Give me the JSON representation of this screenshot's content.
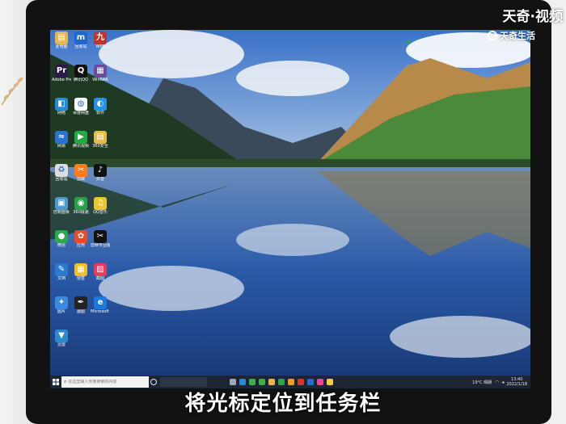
{
  "watermark": {
    "top_text": "天奇·视频",
    "logo_text": "天奇生活"
  },
  "caption": "将光标定位到任务栏",
  "desktop": {
    "icons": [
      {
        "name": "此电脑",
        "color": "#e8b84a",
        "glyph": "▤"
      },
      {
        "name": "回收站",
        "color": "#1e66d0",
        "glyph": "m"
      },
      {
        "name": "WPS",
        "color": "#c0322b",
        "glyph": "九"
      },
      {
        "name": "Adobe Premiere",
        "color": "#2a1a4a",
        "glyph": "Pr"
      },
      {
        "name": "腾讯QQ",
        "color": "#111111",
        "glyph": "Q"
      },
      {
        "name": "WinRAR",
        "color": "#6a4a9a",
        "glyph": "▦"
      },
      {
        "name": "网络",
        "color": "#2a8ad0",
        "glyph": "◧"
      },
      {
        "name": "百度网盘",
        "color": "#ffffff",
        "glyph": "◍"
      },
      {
        "name": "软件",
        "color": "#2a90e0",
        "glyph": "◐"
      },
      {
        "name": "网易",
        "color": "#2a72d0",
        "glyph": "≈"
      },
      {
        "name": "腾讯视频",
        "color": "#22aa44",
        "glyph": "▶"
      },
      {
        "name": "360安全",
        "color": "#e8b84a",
        "glyph": "▤"
      },
      {
        "name": "回收站",
        "color": "#dddddd",
        "glyph": "♻"
      },
      {
        "name": "剪映",
        "color": "#ff7a1a",
        "glyph": "✂"
      },
      {
        "name": "抖音",
        "color": "#111111",
        "glyph": "♪"
      },
      {
        "name": "控制面板",
        "color": "#4a9ad0",
        "glyph": "▣"
      },
      {
        "name": "360极速",
        "color": "#2aa04a",
        "glyph": "◉"
      },
      {
        "name": "QQ音乐",
        "color": "#e8c830",
        "glyph": "♫"
      },
      {
        "name": "微信",
        "color": "#2aa84a",
        "glyph": "●"
      },
      {
        "name": "应用",
        "color": "#e84a2a",
        "glyph": "✿"
      },
      {
        "name": "剪映专业版",
        "color": "#111111",
        "glyph": "✂"
      },
      {
        "name": "文档",
        "color": "#2a7ad0",
        "glyph": "✎"
      },
      {
        "name": "便签",
        "color": "#f0c020",
        "glyph": "▦"
      },
      {
        "name": "截图",
        "color": "#e83a5a",
        "glyph": "▨"
      },
      {
        "name": "图片",
        "color": "#3a8ae0",
        "glyph": "✦"
      },
      {
        "name": "画图",
        "color": "#222222",
        "glyph": "✒"
      },
      {
        "name": "Microsoft Edge",
        "color": "#1a7ae0",
        "glyph": "e"
      },
      {
        "name": "迅雷",
        "color": "#2a8ad0",
        "glyph": "▼"
      }
    ]
  },
  "taskbar": {
    "search_placeholder": "在这里输入你要搜索的内容",
    "tray_weather": "19°C 晴朗",
    "clock_time": "13:40",
    "clock_date": "2022/1/18",
    "apps": [
      {
        "name": "task-view",
        "color": "#9aa8bc"
      },
      {
        "name": "edge",
        "color": "#2a8ad0"
      },
      {
        "name": "chrome",
        "color": "#3ab04a"
      },
      {
        "name": "360",
        "color": "#3ab04a"
      },
      {
        "name": "explorer",
        "color": "#e8b84a"
      },
      {
        "name": "wechat",
        "color": "#2aa84a"
      },
      {
        "name": "folder",
        "color": "#e8a020"
      },
      {
        "name": "wps",
        "color": "#d03a2a"
      },
      {
        "name": "word",
        "color": "#2a6ad0"
      },
      {
        "name": "paint",
        "color": "#e84a8a"
      },
      {
        "name": "notes",
        "color": "#f0d040"
      }
    ]
  }
}
